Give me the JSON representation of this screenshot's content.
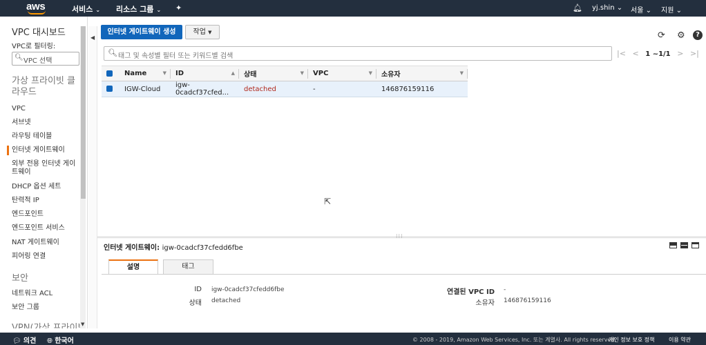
{
  "topbar": {
    "logo": "aws",
    "services": "서비스",
    "resource_groups": "리소스 그룹",
    "user": "yj.shin",
    "region": "서울",
    "support": "지원"
  },
  "sidebar": {
    "title": "VPC 대시보드",
    "filter_label": "VPC로 필터링:",
    "filter_placeholder": "VPC 선택",
    "section_cloud": "가상 프라이빗 클라우드",
    "items": [
      "VPC",
      "서브넷",
      "라우팅 테이블",
      "인터넷 게이트웨이",
      "외부 전용 인터넷 게이트웨이",
      "DHCP 옵션 세트",
      "탄력적 IP",
      "엔드포인트",
      "엔드포인트 서비스",
      "NAT 게이트웨이",
      "피어링 연결"
    ],
    "section_security": "보안",
    "security_items": [
      "네트워크 ACL",
      "보안 그룹"
    ],
    "section_vpn": "VPN(가상 프라이빗"
  },
  "toolbar": {
    "create_label": "인터넷 게이트웨이 생성",
    "action_label": "작업"
  },
  "search": {
    "placeholder": "태그 및 속성별 필터 또는 키워드별 검색"
  },
  "pager": {
    "range": "1 ~1/1"
  },
  "table": {
    "columns": [
      "Name",
      "ID",
      "상태",
      "VPC",
      "소유자"
    ],
    "rows": [
      {
        "name": "IGW-Cloud",
        "id": "igw-0cadcf37cfed...",
        "state": "detached",
        "vpc": "-",
        "owner": "146876159116"
      }
    ]
  },
  "detail": {
    "heading": "인터넷 게이트웨이:",
    "heading_id": "igw-0cadcf37cfedd6fbe",
    "tabs": [
      "설명",
      "태그"
    ],
    "id_label": "ID",
    "id_value": "igw-0cadcf37cfedd6fbe",
    "state_label": "상태",
    "state_value": "detached",
    "vpc_label": "연결된 VPC ID",
    "vpc_value": "-",
    "owner_label": "소유자",
    "owner_value": "146876159116"
  },
  "footer": {
    "feedback": "의견",
    "language": "한국어",
    "copyright": "© 2008 - 2019, Amazon Web Services, Inc. 또는 계열사. All rights reserved.",
    "privacy": "개인 정보 보호 정책",
    "terms": "이용 약관"
  },
  "colors": {
    "nav_bg": "#232f3e",
    "primary": "#1166bb",
    "accent": "#ec7211",
    "detached": "#b0271b"
  }
}
